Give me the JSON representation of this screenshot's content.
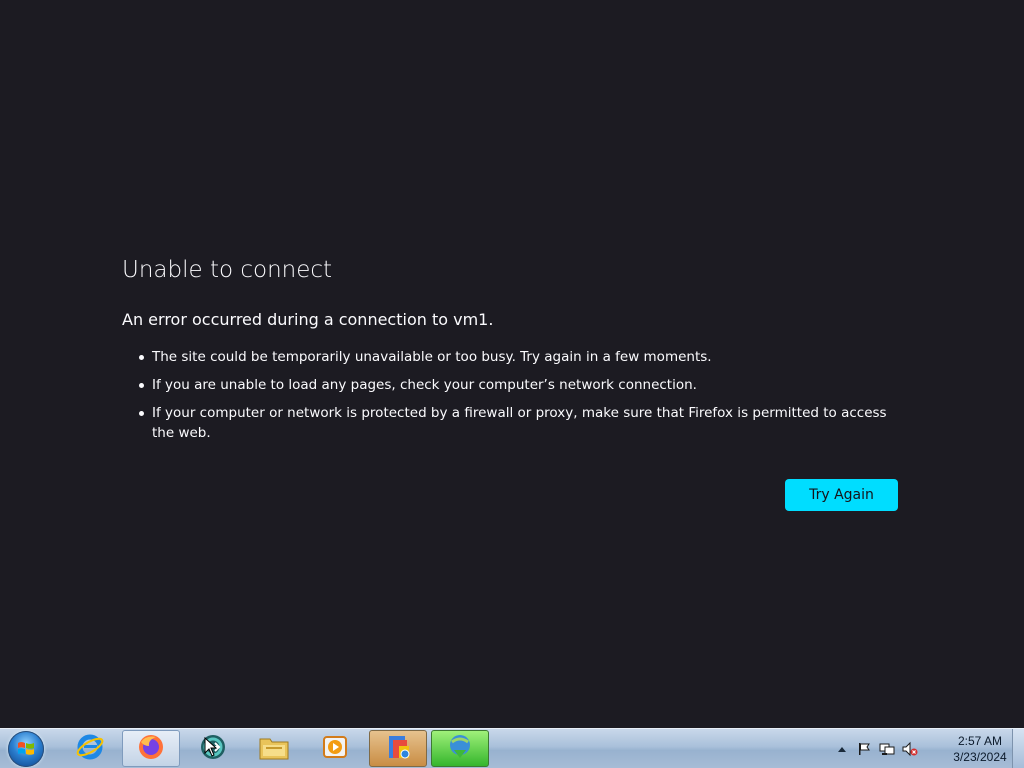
{
  "error_page": {
    "title": "Unable to connect",
    "subtitle": "An error occurred during a connection to vm1.",
    "bullets": [
      "The site could be temporarily unavailable or too busy. Try again in a few moments.",
      "If you are unable to load any pages, check your computer’s network connection.",
      "If your computer or network is protected by a firewall or proxy, make sure that Firefox is permitted to access the web."
    ],
    "try_again_label": "Try Again"
  },
  "taskbar": {
    "items": [
      {
        "name": "internet-explorer-icon",
        "active": false
      },
      {
        "name": "firefox-icon",
        "active": true
      },
      {
        "name": "teamviewer-icon",
        "active": false
      },
      {
        "name": "file-explorer-icon",
        "active": false
      },
      {
        "name": "media-player-icon",
        "active": false
      },
      {
        "name": "installer-icon",
        "active": false
      },
      {
        "name": "download-manager-icon",
        "active": false
      }
    ],
    "clock": {
      "time": "2:57 AM",
      "date": "3/23/2024"
    }
  },
  "colors": {
    "page_background": "#1c1b22",
    "text": "#fbfbfe",
    "accent_button": "#00ddff",
    "taskbar": "#a9c0da"
  }
}
